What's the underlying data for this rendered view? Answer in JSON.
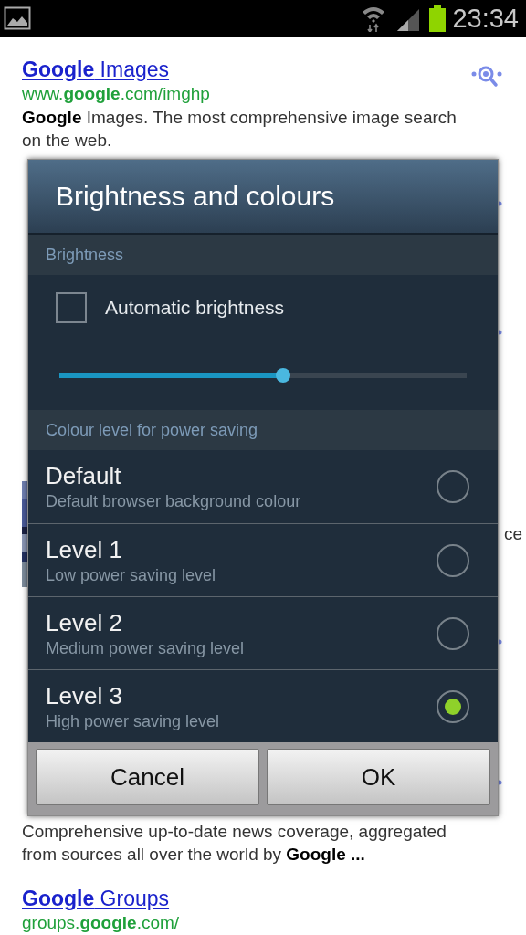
{
  "status_bar": {
    "time": "23:34"
  },
  "results": [
    {
      "title": "**Google** Images",
      "url": "www.**google**.com/imghp",
      "snippet": [
        "**Google** Images. The most comprehensive image search",
        "on the web."
      ],
      "preview_icon": true
    },
    {
      "preview_icon": true
    },
    {
      "preview_icon": true
    },
    {
      "side_text": "ce",
      "preview_icon": false
    },
    {
      "preview_icon": true
    },
    {
      "snippet": [
        "Comprehensive up-to-date news coverage, aggregated",
        "from sources all over the world by **Google ...**"
      ],
      "preview_icon": true
    },
    {
      "title": "**Google** Groups",
      "url": "groups.**google**.com/",
      "preview_icon": false
    }
  ],
  "dialog": {
    "title": "Brightness and colours",
    "brightness_header": "Brightness",
    "auto_brightness": {
      "label": "Automatic brightness",
      "checked": false
    },
    "brightness_slider": {
      "level": 0.55
    },
    "colour_header": "Colour level for power saving",
    "options": [
      {
        "title": "Default",
        "description": "Default browser background colour",
        "selected": false
      },
      {
        "title": "Level 1",
        "description": "Low power saving level",
        "selected": false
      },
      {
        "title": "Level 2",
        "description": "Medium power saving level",
        "selected": false
      },
      {
        "title": "Level 3",
        "description": "High power saving level",
        "selected": true
      }
    ],
    "buttons": [
      "Cancel",
      "OK"
    ]
  }
}
